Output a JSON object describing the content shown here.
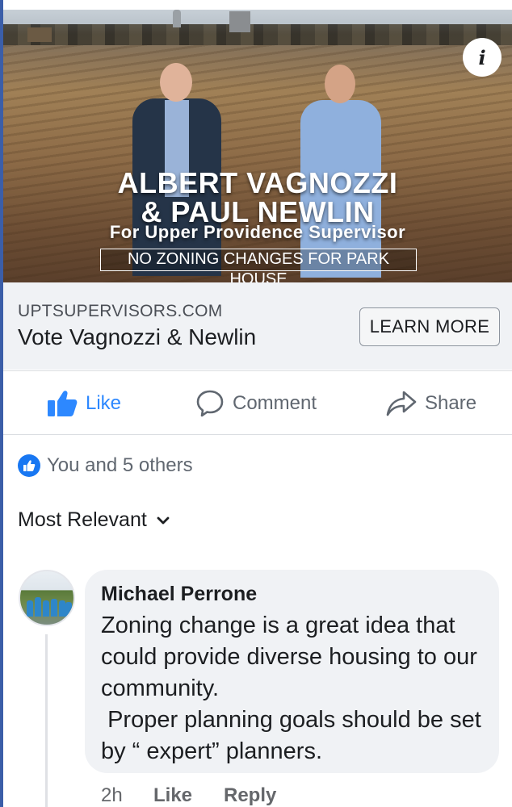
{
  "ad": {
    "title_line1": "ALBERT VAGNOZZI",
    "title_line2": "& PAUL NEWLIN",
    "subtitle": "For Upper Providence Supervisor",
    "tagline": "NO ZONING CHANGES FOR PARK HOUSE",
    "info_icon": "info-icon",
    "info_glyph": "i"
  },
  "link_preview": {
    "domain": "UPTSUPERVISORS.COM",
    "headline": "Vote Vagnozzi & Newlin",
    "cta_label": "LEARN MORE"
  },
  "actions": {
    "like_label": "Like",
    "comment_label": "Comment",
    "share_label": "Share",
    "like_color": "#2d88ff"
  },
  "reactions": {
    "summary": "You and 5 others"
  },
  "comments_sort": {
    "label": "Most Relevant"
  },
  "comment": {
    "author": "Michael Perrone",
    "text": "Zoning change is a great idea that could provide diverse housing to our community.\n Proper planning goals should be set by “ expert” planners.",
    "time": "2h",
    "like_label": "Like",
    "reply_label": "Reply"
  },
  "colors": {
    "accent": "#1877f2",
    "bubble_bg": "#f0f2f5",
    "muted_text": "#65676b"
  }
}
